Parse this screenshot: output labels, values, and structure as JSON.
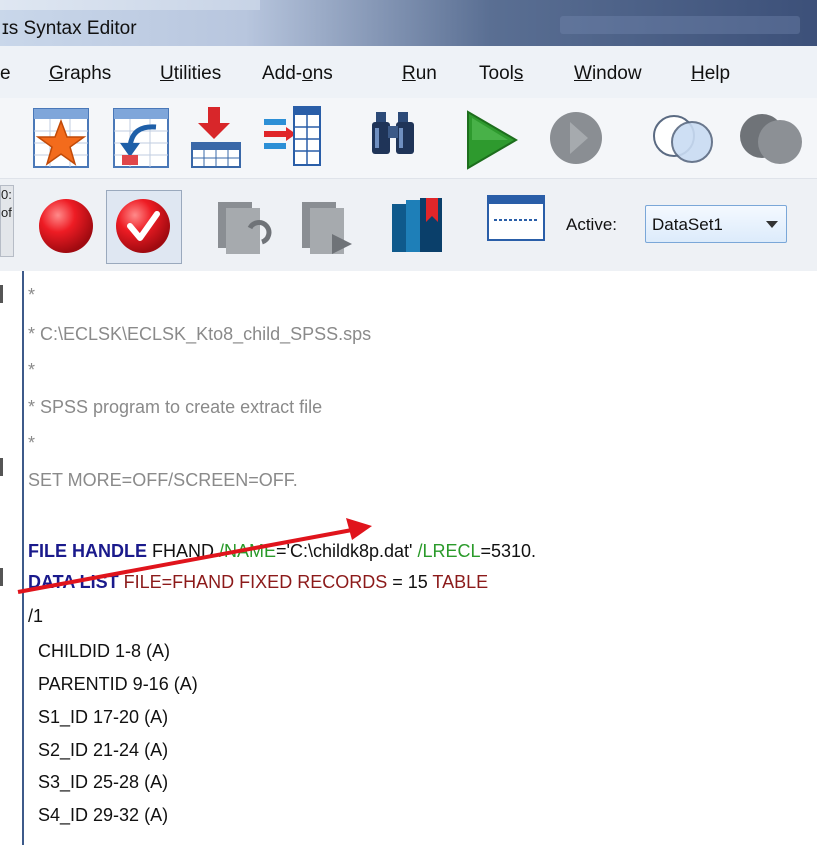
{
  "window": {
    "title": "ɪs Syntax Editor"
  },
  "menu": {
    "items": [
      {
        "id": "e",
        "label": "e"
      },
      {
        "id": "graphs",
        "label": "Graphs"
      },
      {
        "id": "utilities",
        "label": "Utilities"
      },
      {
        "id": "addons",
        "label": "Add-ons"
      },
      {
        "id": "run",
        "label": "Run"
      },
      {
        "id": "tools",
        "label": "Tools"
      },
      {
        "id": "window",
        "label": "Window"
      },
      {
        "id": "help",
        "label": "Help"
      }
    ]
  },
  "toolbar": {
    "active_label": "Active:",
    "dataset_value": "DataSet1"
  },
  "left_panel": {
    "line1": "0:",
    "line2": "of"
  },
  "editor": {
    "lines": [
      {
        "text": "*"
      },
      {
        "text": "* C:\\ECLSK\\ECLSK_Kto8_child_SPSS.sps"
      },
      {
        "text": "*"
      },
      {
        "text": "* SPSS program to create extract file"
      },
      {
        "text": "*"
      },
      {
        "text": "SET MORE=OFF/SCREEN=OFF."
      },
      {
        "text": ""
      },
      {
        "parts": [
          "FILE HANDLE",
          " FHAND ",
          "/NAME",
          "='C:\\childk8p.dat' ",
          "/LRECL",
          "=5310."
        ]
      },
      {
        "parts": [
          "DATA LIST",
          " FILE=FHAND FIXED RECORDS",
          " = 15 ",
          "TABLE"
        ]
      },
      {
        "text": "/1"
      },
      {
        "text": "  CHILDID 1-8 (A)"
      },
      {
        "text": "  PARENTID 9-16 (A)"
      },
      {
        "text": "  S1_ID 17-20 (A)"
      },
      {
        "text": "  S2_ID 21-24 (A)"
      },
      {
        "text": "  S3_ID 25-28 (A)"
      },
      {
        "text": "  S4_ID 29-32 (A)"
      }
    ]
  },
  "colors": {
    "comment": "#8a8a8a",
    "keyword": "#1a1a8c",
    "subcommand": "#2a9a2a",
    "keyword2": "#8c1a1a",
    "annotation_arrow": "#e0141c"
  }
}
